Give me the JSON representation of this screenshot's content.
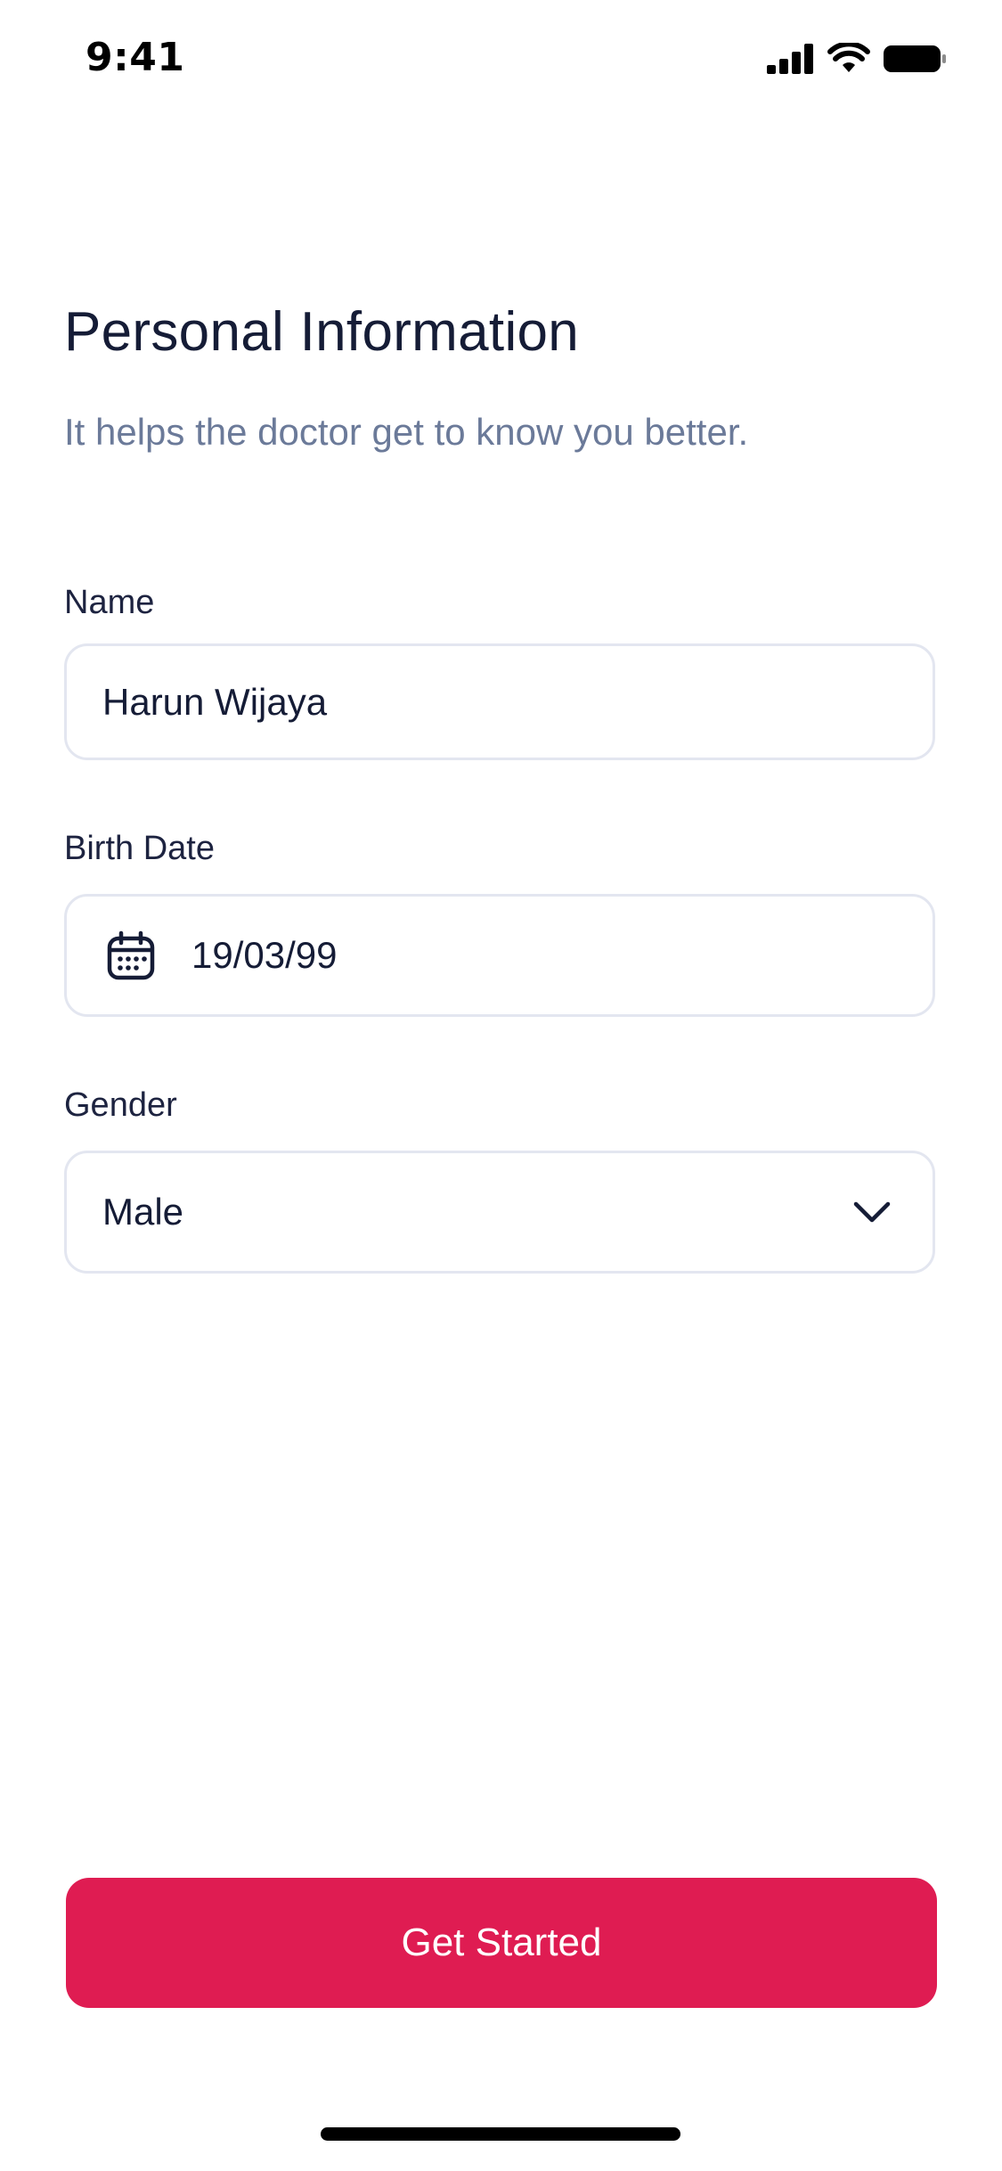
{
  "status_bar": {
    "time": "9:41",
    "icons": [
      "cellular-signal-icon",
      "wifi-icon",
      "battery-icon"
    ]
  },
  "header": {
    "title": "Personal Information",
    "subtitle": "It helps the doctor get to know you better."
  },
  "form": {
    "name": {
      "label": "Name",
      "value": "Harun Wijaya"
    },
    "birth_date": {
      "label": "Birth Date",
      "value": "19/03/99",
      "icon": "calendar-icon"
    },
    "gender": {
      "label": "Gender",
      "value": "Male",
      "icon": "chevron-down-icon"
    }
  },
  "cta": {
    "label": "Get Started"
  },
  "colors": {
    "accent": "#df1c52",
    "title_text": "#151c36",
    "subtitle_text": "#6b7a99",
    "field_border": "#e3e6f0"
  }
}
